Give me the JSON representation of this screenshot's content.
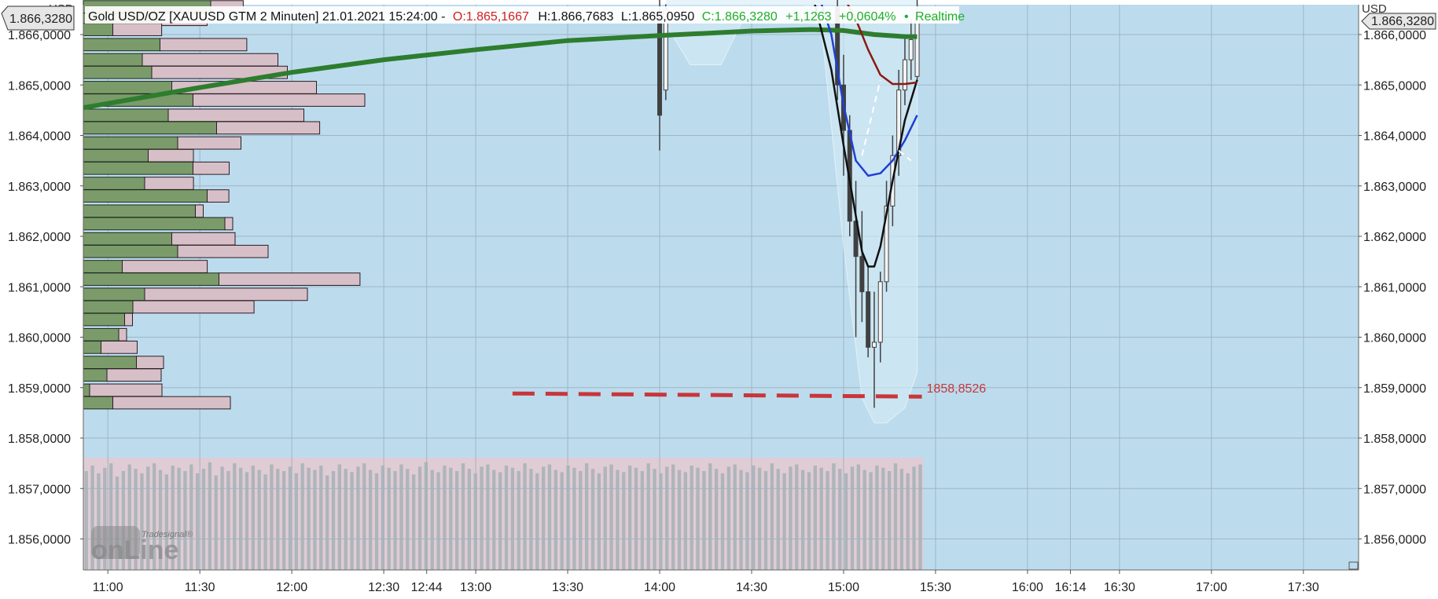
{
  "header": {
    "instrument": "Gold USD/OZ [XAUUSD GTM 2 Minuten] 21.01.2021 15:24:00 -",
    "open": "O:1.865,1667",
    "high": "H:1.866,7683",
    "low": "L:1.865,0950",
    "close": "C:1.866,3280",
    "change": "+1,1263",
    "change_pct": "+0,0604%",
    "status_dot": "•",
    "status": "Realtime"
  },
  "axes": {
    "unit_left": "USD",
    "unit_right": "USD",
    "price_badge_left": "1.866,3280",
    "price_badge_right": "1.866,3280",
    "y_ticks": [
      {
        "value": 1866.0,
        "label": "1.866,0000"
      },
      {
        "value": 1865.0,
        "label": "1.865,0000"
      },
      {
        "value": 1864.0,
        "label": "1.864,0000"
      },
      {
        "value": 1863.0,
        "label": "1.863,0000"
      },
      {
        "value": 1862.0,
        "label": "1.862,0000"
      },
      {
        "value": 1861.0,
        "label": "1.861,0000"
      },
      {
        "value": 1860.0,
        "label": "1.860,0000"
      },
      {
        "value": 1859.0,
        "label": "1.859,0000"
      },
      {
        "value": 1858.0,
        "label": "1.858,0000"
      },
      {
        "value": 1857.0,
        "label": "1.857,0000"
      },
      {
        "value": 1856.0,
        "label": "1.856,0000"
      }
    ],
    "x_ticks": [
      {
        "t": "11:00",
        "label": "11:00"
      },
      {
        "t": "11:30",
        "label": "11:30"
      },
      {
        "t": "12:00",
        "label": "12:00"
      },
      {
        "t": "12:30",
        "label": "12:30"
      },
      {
        "t": "12:44",
        "label": "12:44"
      },
      {
        "t": "13:00",
        "label": "13:00"
      },
      {
        "t": "13:30",
        "label": "13:30"
      },
      {
        "t": "14:00",
        "label": "14:00"
      },
      {
        "t": "14:30",
        "label": "14:30"
      },
      {
        "t": "15:00",
        "label": "15:00"
      },
      {
        "t": "15:30",
        "label": "15:30"
      },
      {
        "t": "16:00",
        "label": "16:00"
      },
      {
        "t": "16:14",
        "label": "16:14"
      },
      {
        "t": "16:30",
        "label": "16:30"
      },
      {
        "t": "17:00",
        "label": "17:00"
      },
      {
        "t": "17:30",
        "label": "17:30"
      }
    ]
  },
  "watermark": {
    "brand_small": "Tradesignal®",
    "brand_large": "onLine"
  },
  "colors": {
    "plot_bg": "#bcdcee",
    "grid": "#9fb5c3",
    "vp_buy": "#7b9b6b",
    "vp_sell": "#d7bfc8",
    "poc_line": "#2e7d2e",
    "support_line": "#c8363a",
    "candle": "#404040",
    "ma_blue": "#1f3fd6",
    "ma_black": "#111111",
    "ma_brown": "#8b1a10",
    "vol_bar": "#a8b2b8",
    "vol_bg": "#e6c9cf",
    "header_open": "#d32020",
    "header_close": "#1fae28"
  },
  "chart_data": {
    "type": "candlestick",
    "title": "Gold USD/OZ [XAUUSD GTM 2 Minuten] 21.01.2021 15:24:00",
    "y_unit": "USD",
    "ylim": [
      1855.45,
      1866.75
    ],
    "xlim": [
      "10:52",
      "17:48"
    ],
    "grid": true,
    "support_level": {
      "value": 1858.8526,
      "label": "1858,8526",
      "from": "13:12",
      "to": "15:24"
    },
    "volume_profile": {
      "bins": [
        {
          "price": 1866.55,
          "buy": 1866.03,
          "sell": 1865.78
        },
        {
          "price": 1866.3,
          "buy": 1865.57,
          "sell": 1865.88
        },
        {
          "price": 1866.1,
          "buy": 1865.2,
          "sell": 1865.87
        },
        {
          "price": 1865.8,
          "buy": 1865.6,
          "sell": 1866.08
        },
        {
          "price": 1865.5,
          "buy": 1865.45,
          "sell": 1866.35
        },
        {
          "price": 1865.25,
          "buy": 1865.53,
          "sell": 1866.35
        },
        {
          "price": 1864.95,
          "buy": 1865.7,
          "sell": 1866.4
        },
        {
          "price": 1864.7,
          "buy": 1865.88,
          "sell": 1866.55
        },
        {
          "price": 1864.4,
          "buy": 1865.67,
          "sell": 1866.35
        },
        {
          "price": 1864.15,
          "buy": 1866.08,
          "sell": 1866.17
        },
        {
          "price": 1863.85,
          "buy": 1865.75,
          "sell": 1865.95
        },
        {
          "price": 1863.6,
          "buy": 1865.5,
          "sell": 1865.85
        },
        {
          "price": 1863.35,
          "buy": 1865.88,
          "sell": 1865.8
        },
        {
          "price": 1863.05,
          "buy": 1865.47,
          "sell": 1865.87
        },
        {
          "price": 1862.8,
          "buy": 1866.0,
          "sell": 1865.72
        },
        {
          "price": 1862.5,
          "buy": 1865.9,
          "sell": 1865.52
        },
        {
          "price": 1862.25,
          "buy": 1866.15,
          "sell": 1865.42
        },
        {
          "price": 1861.95,
          "buy": 1865.7,
          "sell": 1865.95
        },
        {
          "price": 1861.7,
          "buy": 1865.75,
          "sell": 1866.1
        },
        {
          "price": 1861.4,
          "buy": 1865.28,
          "sell": 1866.07
        },
        {
          "price": 1861.15,
          "buy": 1866.1,
          "sell": 1866.38
        },
        {
          "price": 1860.85,
          "buy": 1865.47,
          "sell": 1866.5
        },
        {
          "price": 1860.6,
          "buy": 1865.37,
          "sell": 1866.27
        },
        {
          "price": 1860.35,
          "buy": 1865.3,
          "sell": 1865.43
        },
        {
          "price": 1860.05,
          "buy": 1865.25,
          "sell": 1865.55
        },
        {
          "price": 1859.8,
          "buy": 1865.1,
          "sell": 1865.8
        },
        {
          "price": 1859.5,
          "buy": 1865.4,
          "sell": 1865.75
        },
        {
          "price": 1859.25,
          "buy": 1865.15,
          "sell": 1865.9
        },
        {
          "price": 1858.95,
          "buy": 1865.0,
          "sell": 1866.0
        },
        {
          "price": 1858.7,
          "buy": 1865.2,
          "sell": 1866.25
        }
      ]
    },
    "candles": [
      {
        "t": "14:00",
        "o": 1866.45,
        "h": 1866.75,
        "l": 1863.7,
        "c": 1864.4
      },
      {
        "t": "14:02",
        "o": 1864.9,
        "h": 1866.6,
        "l": 1864.7,
        "c": 1866.5
      },
      {
        "t": "14:58",
        "o": 1866.55,
        "h": 1866.75,
        "l": 1864.7,
        "c": 1865.0
      },
      {
        "t": "15:00",
        "o": 1865.0,
        "h": 1865.6,
        "l": 1863.2,
        "c": 1864.1
      },
      {
        "t": "15:02",
        "o": 1864.1,
        "h": 1864.4,
        "l": 1862.0,
        "c": 1862.3
      },
      {
        "t": "15:04",
        "o": 1862.3,
        "h": 1863.1,
        "l": 1860.0,
        "c": 1861.6
      },
      {
        "t": "15:06",
        "o": 1861.6,
        "h": 1862.5,
        "l": 1860.3,
        "c": 1860.9
      },
      {
        "t": "15:08",
        "o": 1860.9,
        "h": 1861.4,
        "l": 1859.6,
        "c": 1859.8
      },
      {
        "t": "15:10",
        "o": 1859.8,
        "h": 1860.9,
        "l": 1858.6,
        "c": 1859.9
      },
      {
        "t": "15:12",
        "o": 1859.9,
        "h": 1861.3,
        "l": 1859.5,
        "c": 1861.1
      },
      {
        "t": "15:14",
        "o": 1861.1,
        "h": 1863.1,
        "l": 1860.9,
        "c": 1862.6
      },
      {
        "t": "15:16",
        "o": 1862.6,
        "h": 1864.0,
        "l": 1862.2,
        "c": 1863.6
      },
      {
        "t": "15:18",
        "o": 1863.6,
        "h": 1865.3,
        "l": 1863.2,
        "c": 1864.9
      },
      {
        "t": "15:20",
        "o": 1864.9,
        "h": 1866.0,
        "l": 1864.6,
        "c": 1865.5
      },
      {
        "t": "15:22",
        "o": 1865.5,
        "h": 1866.3,
        "l": 1865.1,
        "c": 1865.9
      },
      {
        "t": "15:24",
        "o": 1865.17,
        "h": 1866.77,
        "l": 1865.1,
        "c": 1866.33
      }
    ],
    "series": [
      {
        "type": "line",
        "x": [
          "10:52",
          "11:30",
          "12:00",
          "12:30",
          "13:00",
          "13:30",
          "14:00",
          "14:30",
          "14:50",
          "15:00",
          "15:10",
          "15:20",
          "15:24"
        ],
        "values": [
          1864.55,
          1864.95,
          1865.25,
          1865.5,
          1865.7,
          1865.88,
          1865.98,
          1866.07,
          1866.1,
          1866.08,
          1866.0,
          1865.96,
          1865.96
        ]
      },
      {
        "type": "line",
        "x": [
          "14:52",
          "14:56",
          "15:00",
          "15:04",
          "15:08",
          "15:12",
          "15:16",
          "15:20",
          "15:24"
        ],
        "values": [
          1866.75,
          1866.0,
          1864.6,
          1863.5,
          1863.2,
          1863.25,
          1863.5,
          1863.9,
          1864.4
        ]
      },
      {
        "type": "line",
        "x": [
          "14:50",
          "14:56",
          "15:00",
          "15:04",
          "15:06",
          "15:08",
          "15:10",
          "15:12",
          "15:16",
          "15:20",
          "15:24"
        ],
        "values": [
          1866.75,
          1865.3,
          1863.8,
          1862.4,
          1861.7,
          1861.4,
          1861.4,
          1861.8,
          1863.1,
          1864.3,
          1865.1
        ]
      },
      {
        "type": "line",
        "x": [
          "15:00",
          "15:04",
          "15:08",
          "15:12",
          "15:16",
          "15:20",
          "15:24"
        ],
        "values": [
          1866.75,
          1866.3,
          1865.7,
          1865.2,
          1865.02,
          1865.02,
          1865.05
        ]
      }
    ],
    "volume": {
      "x_start": "10:52",
      "x_end": "15:24",
      "bar_levels": [
        0.9,
        0.95,
        0.88,
        0.93,
        0.97,
        0.85,
        0.9,
        0.96,
        0.92,
        0.88,
        0.94,
        0.97,
        0.91,
        0.87,
        0.95,
        0.93,
        0.9,
        0.96,
        0.88,
        0.92,
        0.98,
        0.86,
        0.94,
        0.9,
        0.97,
        0.93,
        0.89,
        0.95,
        0.91,
        0.87,
        0.96,
        0.92,
        0.9,
        0.94,
        0.88,
        0.97,
        0.93,
        0.91,
        0.95,
        0.86,
        0.9,
        0.96,
        0.92,
        0.89,
        0.94,
        0.97,
        0.91,
        0.88,
        0.95,
        0.93,
        0.9,
        0.96,
        0.92,
        0.87,
        0.94,
        0.98,
        0.91,
        0.89,
        0.95,
        0.93,
        0.9,
        0.97,
        0.92,
        0.88,
        0.94,
        0.96,
        0.91,
        0.89,
        0.95,
        0.93,
        0.9,
        0.97,
        0.92,
        0.88,
        0.94,
        0.96,
        0.91,
        0.89,
        0.95,
        0.93,
        0.9,
        0.97,
        0.92,
        0.88,
        0.94,
        0.96,
        0.91,
        0.89,
        0.95,
        0.93,
        0.9,
        0.97,
        0.92,
        0.88,
        0.94,
        0.96,
        0.91,
        0.89,
        0.95,
        0.93,
        0.9,
        0.97,
        0.92,
        0.88,
        0.94,
        0.96,
        0.91,
        0.89,
        0.95,
        0.93,
        0.9,
        0.97,
        0.92,
        0.88,
        0.94,
        0.96,
        0.91,
        0.89,
        0.95,
        0.93,
        0.9,
        0.97,
        0.92,
        0.88,
        0.94,
        0.96,
        0.91,
        0.89,
        0.95,
        0.93,
        0.9,
        0.97,
        0.92,
        0.88,
        0.94,
        0.96
      ]
    }
  }
}
